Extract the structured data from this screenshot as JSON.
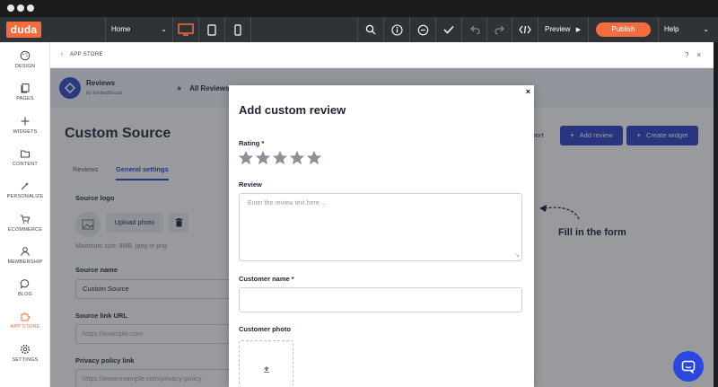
{
  "toolbar": {
    "logo": "duda",
    "page_select": "Home",
    "preview_label": "Preview",
    "publish_label": "Publish",
    "help_label": "Help",
    "icons": [
      "desktop-icon",
      "tablet-icon",
      "mobile-icon",
      "search-icon",
      "info-icon",
      "comment-icon",
      "check-icon",
      "undo-icon",
      "redo-icon",
      "code-icon"
    ],
    "accent": "#f26c3d"
  },
  "sidebar": {
    "items": [
      {
        "label": "DESIGN",
        "icon": "palette-icon"
      },
      {
        "label": "PAGES",
        "icon": "pages-icon"
      },
      {
        "label": "WIDGETS",
        "icon": "plus-icon"
      },
      {
        "label": "CONTENT",
        "icon": "folder-icon"
      },
      {
        "label": "PERSONALIZE",
        "icon": "personalize-icon"
      },
      {
        "label": "ECOMMERCE",
        "icon": "cart-icon"
      },
      {
        "label": "MEMBERSHIP",
        "icon": "person-icon"
      },
      {
        "label": "BLOG",
        "icon": "chat-icon"
      },
      {
        "label": "APP STORE",
        "icon": "puzzle-icon",
        "active": true
      },
      {
        "label": "SETTINGS",
        "icon": "gear-icon"
      }
    ]
  },
  "appbar": {
    "back_label": "APP STORE",
    "help": "?",
    "close": "×"
  },
  "app": {
    "name": "Reviews",
    "by": "by EmbedSocial",
    "nav_item": "All Reviews",
    "page_title": "Custom Source",
    "tabs": [
      {
        "label": "Reviews",
        "active": false
      },
      {
        "label": "General settings",
        "active": true
      }
    ],
    "source_logo_label": "Source logo",
    "upload_label": "Upload photo",
    "hint": "Maximum size: 8MB, jpeg or png",
    "source_name_label": "Source name",
    "source_name_value": "Custom Source",
    "source_link_label": "Source link URL",
    "source_link_placeholder": "https://example.com",
    "privacy_label": "Privacy policy link",
    "privacy_placeholder": "https://www.example.com/privacy-policy",
    "import_label": "nport",
    "add_review_label": "Add review",
    "create_widget_label": "Create widget",
    "brand_blue": "#2b3fc2"
  },
  "annotation": "Fill in the form",
  "modal": {
    "title": "Add custom review",
    "close": "×",
    "rating_label": "Rating *",
    "stars": 5,
    "review_label": "Review",
    "review_placeholder": "Enter the review text here ...",
    "customer_name_label": "Customer name *",
    "customer_photo_label": "Customer photo"
  }
}
